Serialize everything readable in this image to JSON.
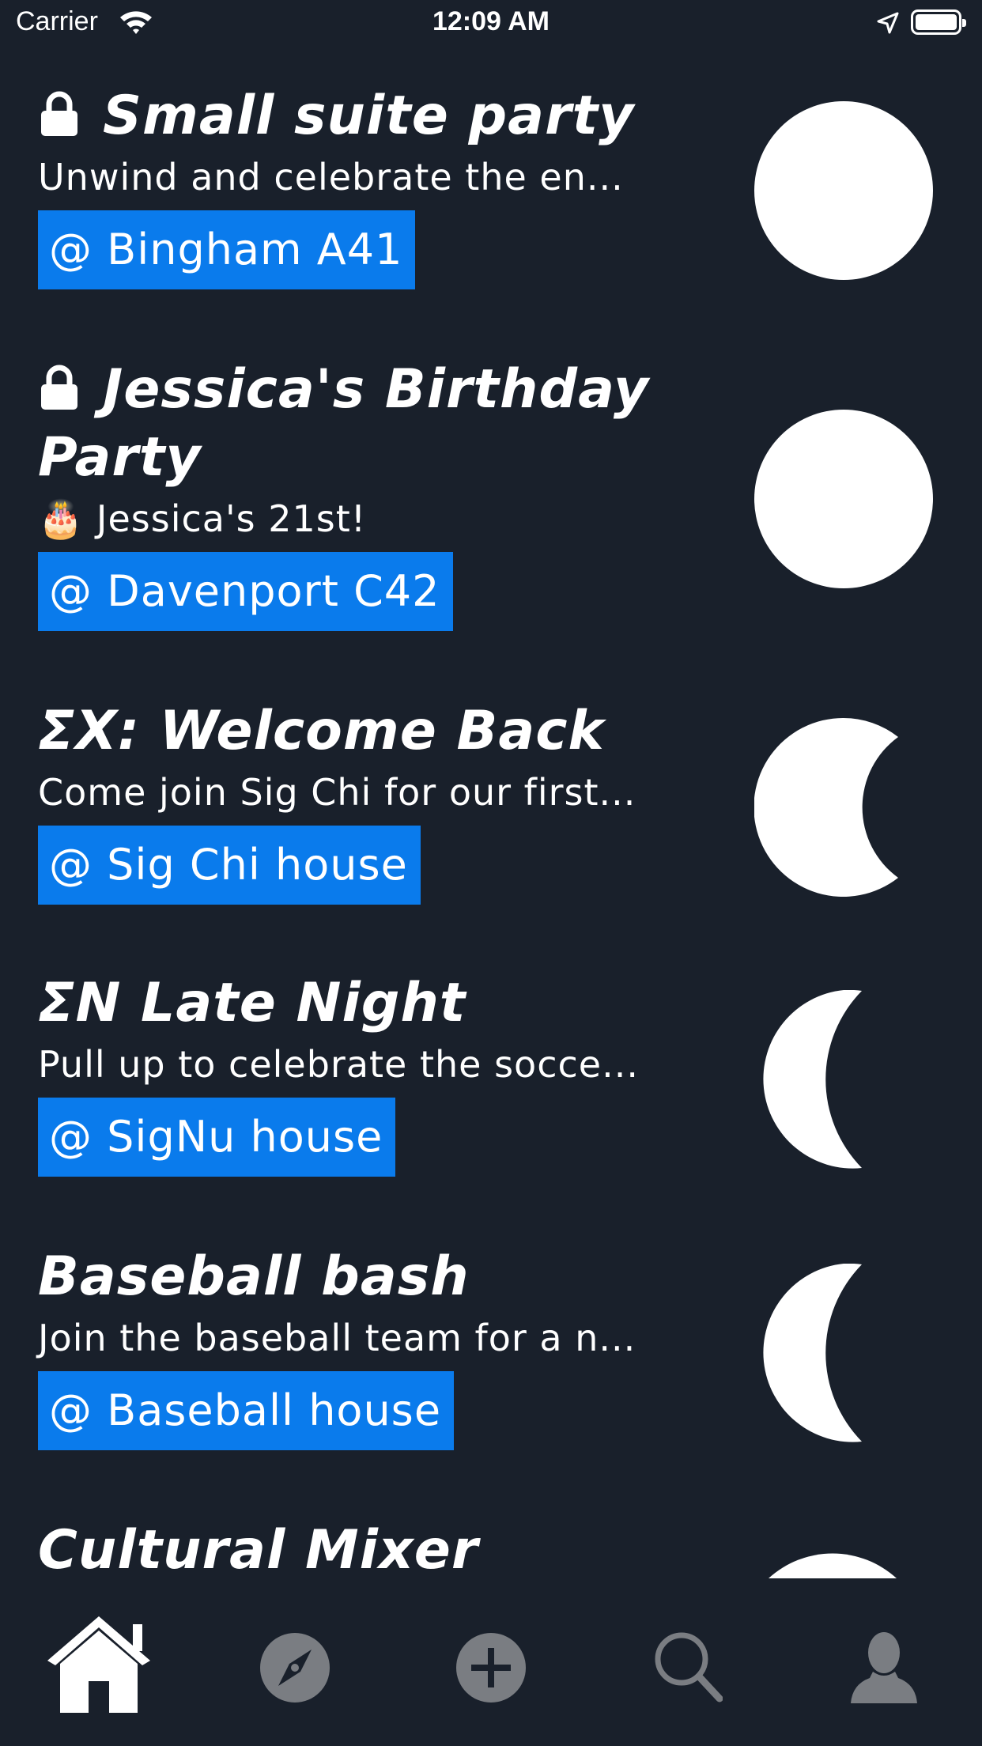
{
  "status_bar": {
    "carrier": "Carrier",
    "time": "12:09 AM"
  },
  "events": [
    {
      "title": "Small suite party",
      "private": true,
      "description": "Unwind and celebrate the en...",
      "location": "@ Bingham A41",
      "moon_phase": "full moon"
    },
    {
      "title": "Jessica's Birthday Party",
      "private": true,
      "description": "🎂 Jessica's 21st!",
      "location": "@ Davenport C42",
      "moon_phase": "full moon"
    },
    {
      "title": "ΣX: Welcome Back",
      "private": false,
      "description": "Come join Sig Chi for our first...",
      "location": "@ Sig Chi house",
      "moon_phase": "gibbous moon"
    },
    {
      "title": "ΣN Late Night",
      "private": false,
      "description": "Pull up to celebrate the socce...",
      "location": "@ SigNu house",
      "moon_phase": "crescent moon"
    },
    {
      "title": "Baseball bash",
      "private": false,
      "description": "Join the baseball team for a n...",
      "location": "@ Baseball house",
      "moon_phase": "crescent moon"
    },
    {
      "title": "Cultural Mixer",
      "private": false,
      "moon_phase": "partial moon"
    }
  ],
  "tab_bar": [
    "home-icon",
    "explore-icon",
    "add-icon",
    "search-icon",
    "profile-icon"
  ],
  "colors": {
    "background": "#19202b",
    "location_badge": "#0a7bec",
    "tab_inactive": "#7a7d82"
  }
}
